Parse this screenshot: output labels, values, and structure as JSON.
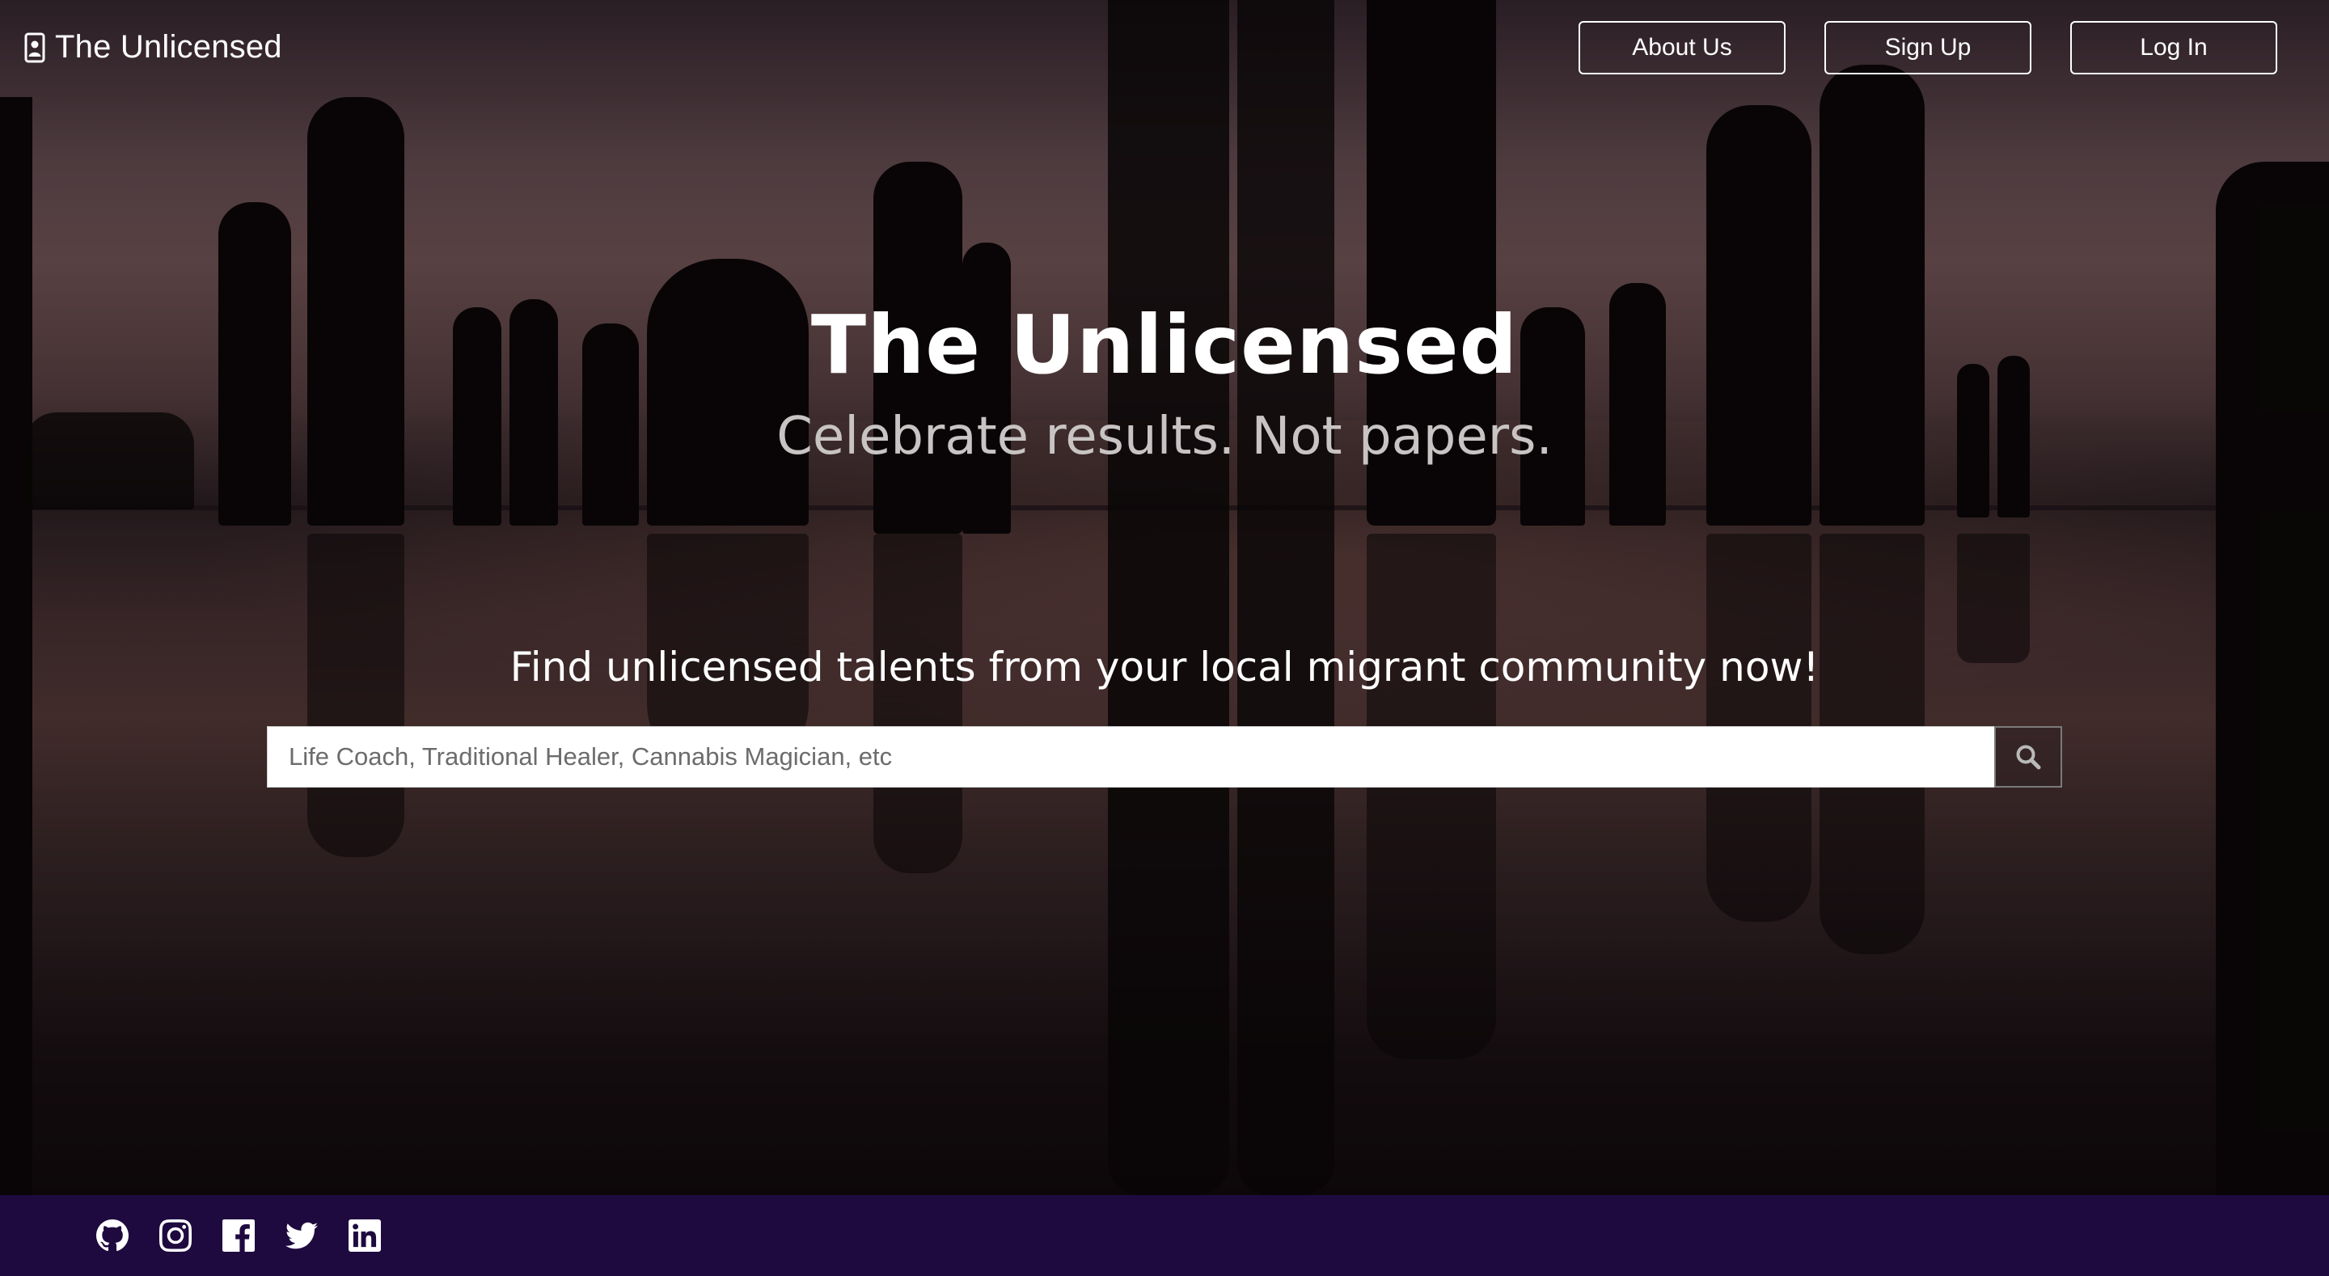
{
  "brand": {
    "name": "The Unlicensed",
    "icon": "id-badge-icon"
  },
  "nav": {
    "items": [
      {
        "label": "About Us"
      },
      {
        "label": "Sign Up"
      },
      {
        "label": "Log In"
      }
    ]
  },
  "hero": {
    "title": "The Unlicensed",
    "subtitle": "Celebrate results. Not papers.",
    "cta": "Find unlicensed talents from your local migrant community now!"
  },
  "search": {
    "value": "",
    "placeholder": "Life Coach, Traditional Healer, Cannabis Magician, etc",
    "button_icon": "search-icon"
  },
  "footer": {
    "background_color": "#1e0a3f",
    "social_icons": [
      "github-icon",
      "instagram-icon",
      "facebook-icon",
      "twitter-icon",
      "linkedin-icon"
    ]
  }
}
